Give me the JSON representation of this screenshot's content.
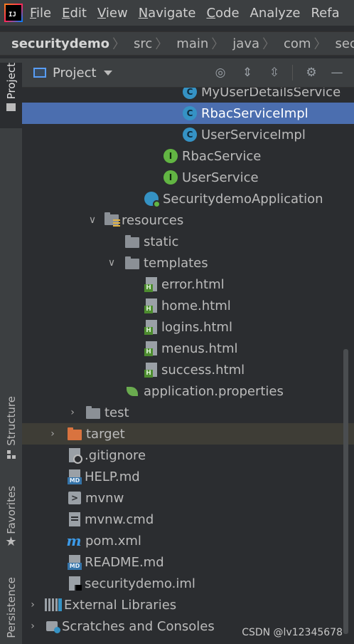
{
  "menu": {
    "app_logo": "IJ",
    "items": [
      {
        "first": "F",
        "rest": "ile"
      },
      {
        "first": "E",
        "rest": "dit"
      },
      {
        "first": "V",
        "rest": "iew"
      },
      {
        "first": "N",
        "rest": "avigate"
      },
      {
        "first": "C",
        "rest": "ode"
      },
      {
        "first": "",
        "rest": "Analyze"
      },
      {
        "first": "",
        "rest": "Refa"
      }
    ]
  },
  "breadcrumb": [
    "securitydemo",
    "src",
    "main",
    "java",
    "com",
    "securitydem"
  ],
  "left_strip": {
    "project": "Project",
    "structure": "Structure",
    "favorites": "Favorites",
    "persistence": "Persistence"
  },
  "panel": {
    "title": "Project",
    "tools": [
      "locate-icon",
      "expand-all-icon",
      "collapse-all-icon",
      "settings-icon",
      "minimize-icon"
    ]
  },
  "tree": [
    {
      "label": "MyUserDetailsService",
      "icon": "class-icon",
      "expander": "",
      "state": ""
    },
    {
      "label": "RbacServiceImpl",
      "icon": "class-icon",
      "expander": "",
      "state": "selected"
    },
    {
      "label": "UserServiceImpl",
      "icon": "class-icon",
      "expander": "",
      "state": ""
    },
    {
      "label": "RbacService",
      "icon": "interface-icon",
      "expander": "",
      "state": ""
    },
    {
      "label": "UserService",
      "icon": "interface-icon",
      "expander": "",
      "state": ""
    },
    {
      "label": "SecuritydemoApplication",
      "icon": "spring-boot-app-icon",
      "expander": "",
      "state": ""
    },
    {
      "label": "resources",
      "icon": "resources-folder-icon",
      "expander": "expanded",
      "state": ""
    },
    {
      "label": "static",
      "icon": "folder-icon",
      "expander": "",
      "state": ""
    },
    {
      "label": "templates",
      "icon": "folder-icon",
      "expander": "expanded",
      "state": ""
    },
    {
      "label": "error.html",
      "icon": "html-file-icon",
      "expander": "",
      "state": ""
    },
    {
      "label": "home.html",
      "icon": "html-file-icon",
      "expander": "",
      "state": ""
    },
    {
      "label": "logins.html",
      "icon": "html-file-icon",
      "expander": "",
      "state": ""
    },
    {
      "label": "menus.html",
      "icon": "html-file-icon",
      "expander": "",
      "state": ""
    },
    {
      "label": "success.html",
      "icon": "html-file-icon",
      "expander": "",
      "state": ""
    },
    {
      "label": "application.properties",
      "icon": "spring-properties-icon",
      "expander": "",
      "state": ""
    },
    {
      "label": "test",
      "icon": "folder-icon",
      "expander": "collapsed",
      "state": ""
    },
    {
      "label": "target",
      "icon": "excluded-folder-icon",
      "expander": "collapsed",
      "state": "excluded"
    },
    {
      "label": ".gitignore",
      "icon": "gitignore-icon",
      "expander": "",
      "state": ""
    },
    {
      "label": "HELP.md",
      "icon": "markdown-icon",
      "expander": "",
      "state": ""
    },
    {
      "label": "mvnw",
      "icon": "shell-script-icon",
      "expander": "",
      "state": ""
    },
    {
      "label": "mvnw.cmd",
      "icon": "text-file-icon",
      "expander": "",
      "state": ""
    },
    {
      "label": "pom.xml",
      "icon": "maven-icon",
      "expander": "",
      "state": ""
    },
    {
      "label": "README.md",
      "icon": "markdown-icon",
      "expander": "",
      "state": ""
    },
    {
      "label": "securitydemo.iml",
      "icon": "iml-file-icon",
      "expander": "",
      "state": ""
    },
    {
      "label": "External Libraries",
      "icon": "libraries-icon",
      "expander": "collapsed",
      "state": ""
    },
    {
      "label": "Scratches and Consoles",
      "icon": "scratches-icon",
      "expander": "collapsed",
      "state": ""
    }
  ],
  "watermark": "CSDN @lv12345678",
  "colors": {
    "selection": "#4b6eaf",
    "excluded_row": "#3e3d36",
    "class_icon": "#3592c4",
    "interface_icon": "#62b543",
    "excluded_folder": "#d9733f"
  }
}
